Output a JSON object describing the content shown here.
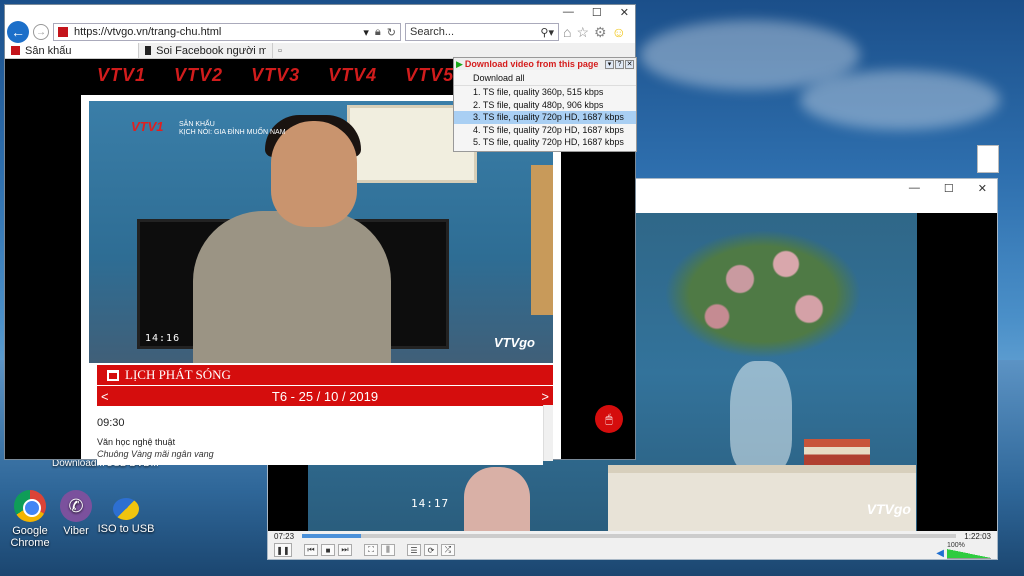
{
  "browser": {
    "url": "https://vtvgo.vn/trang-chu.html",
    "search_placeholder": "Search...",
    "tabs": [
      {
        "label": "Sân khấu"
      },
      {
        "label": "Soi Facebook người mẫu \"xôi t..."
      }
    ],
    "window_controls": {
      "minimize": "—",
      "maximize": "☐",
      "close": "✕"
    }
  },
  "page": {
    "channels": [
      "VTV1",
      "VTV2",
      "VTV3",
      "VTV4",
      "VTV5"
    ],
    "video": {
      "logo": "VTV1",
      "show_line1": "SÂN KHẤU",
      "show_line2": "KỊCH NÓI: GIA ĐÌNH MUỐN NAM",
      "time_osd": "14:16",
      "watermark": "VTVgo"
    },
    "schedule": {
      "header": "LỊCH PHÁT SÓNG",
      "prev": "<",
      "date": "T6 - 25 / 10 / 2019",
      "next": ">",
      "entries": [
        {
          "time": "09:30",
          "title": "Văn học nghệ thuật",
          "subtitle": "Chuông Vàng mãi ngân vang"
        }
      ]
    }
  },
  "download_popup": {
    "title": "Download video from this page",
    "download_all": "Download all",
    "items": [
      {
        "label": "1.  TS file, quality 360p, 515 kbps",
        "selected": false
      },
      {
        "label": "2.  TS file, quality 480p, 906 kbps",
        "selected": false
      },
      {
        "label": "3.  TS file, quality 720p HD, 1687 kbps",
        "selected": true
      },
      {
        "label": "4.  TS file, quality 720p HD, 1687 kbps",
        "selected": false
      },
      {
        "label": "5.  TS file, quality 720p HD, 1687 kbps",
        "selected": false
      }
    ]
  },
  "player": {
    "time_osd": "14:17",
    "watermark": "VTVgo",
    "elapsed": "07:23",
    "duration": "1:22:03",
    "progress": 0.09,
    "volume": "100%"
  },
  "desktop": {
    "icons": [
      {
        "label": "Google Chrome"
      },
      {
        "label": "Viber"
      },
      {
        "label": "ISO to USB"
      }
    ],
    "partial_labels": [
      "Download...",
      "USB DVD..."
    ]
  },
  "colors": {
    "vtv_red": "#d50d0d",
    "ie_blue": "#1c6fc9",
    "selection": "#a9cff3"
  }
}
